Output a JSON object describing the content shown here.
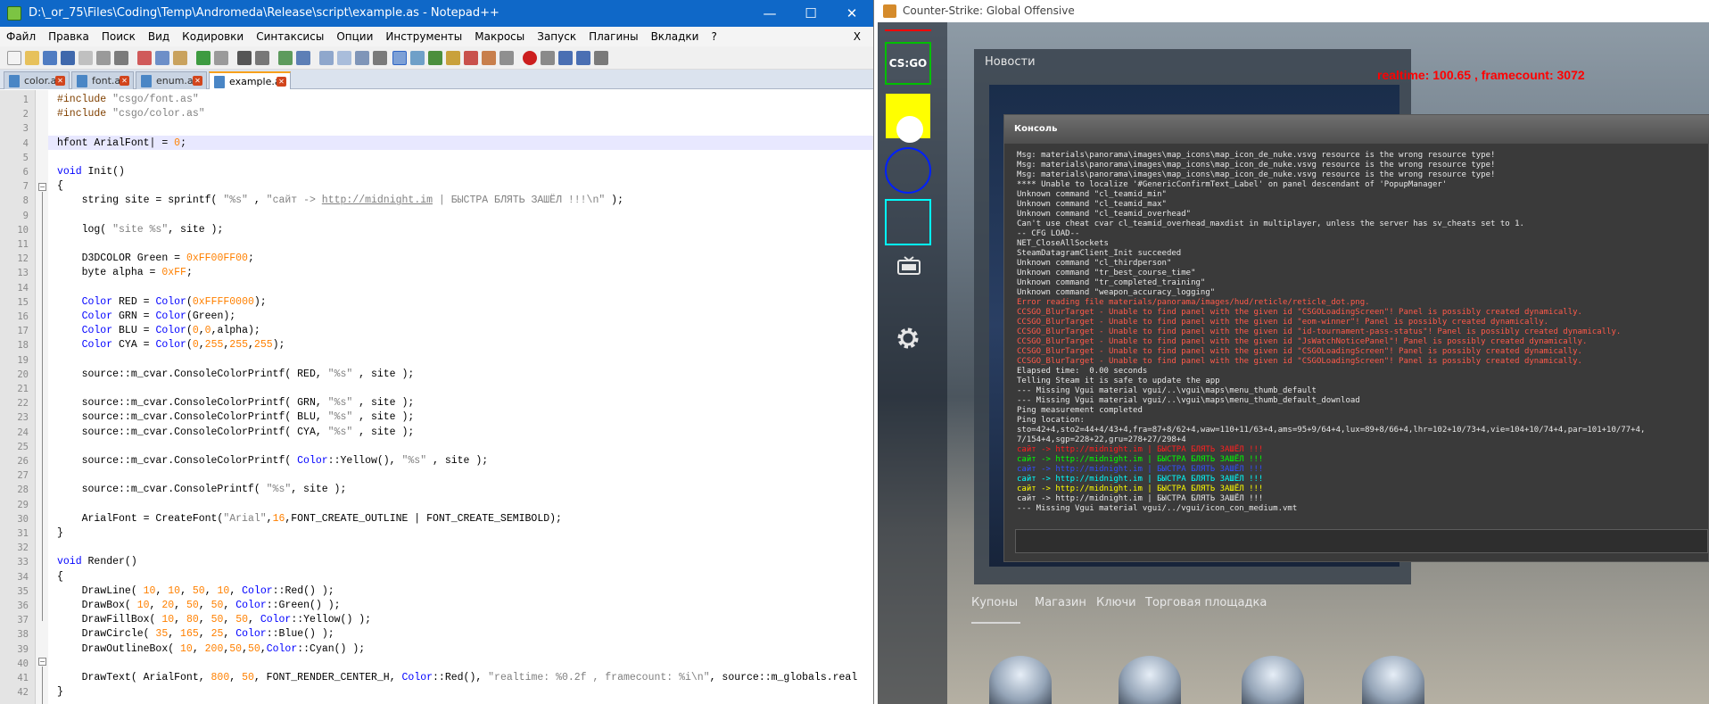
{
  "npp": {
    "title": "D:\\_or_75\\Files\\Coding\\Temp\\Andromeda\\Release\\script\\example.as - Notepad++",
    "window_min": "—",
    "window_max": "☐",
    "window_close": "✕",
    "menu": [
      "Файл",
      "Правка",
      "Поиск",
      "Вид",
      "Кодировки",
      "Синтаксисы",
      "Опции",
      "Инструменты",
      "Макросы",
      "Запуск",
      "Плагины",
      "Вкладки",
      "?"
    ],
    "menu_close": "X",
    "tabs": [
      {
        "label": "color.as",
        "active": false
      },
      {
        "label": "font.as",
        "active": false
      },
      {
        "label": "enum.as",
        "active": false
      },
      {
        "label": "example.as",
        "active": true
      }
    ],
    "tab_close": "✕",
    "line_numbers": [
      "1",
      "2",
      "3",
      "4",
      "5",
      "6",
      "7",
      "8",
      "9",
      "10",
      "11",
      "12",
      "13",
      "14",
      "15",
      "16",
      "17",
      "18",
      "19",
      "20",
      "21",
      "22",
      "23",
      "24",
      "25",
      "26",
      "27",
      "28",
      "29",
      "30",
      "31",
      "32",
      "33",
      "34",
      "35",
      "36",
      "37",
      "38",
      "39",
      "40",
      "41",
      "42"
    ],
    "code": [
      [
        {
          "t": "#include ",
          "c": "p"
        },
        {
          "t": "\"csgo/font.as\"",
          "c": "s"
        }
      ],
      [
        {
          "t": "#include ",
          "c": "p"
        },
        {
          "t": "\"csgo/color.as\"",
          "c": "s"
        }
      ],
      [],
      [
        {
          "t": "hfont ArialFont",
          "c": ""
        },
        {
          "t": "|",
          "c": ""
        },
        {
          "t": " = ",
          "c": ""
        },
        {
          "t": "0",
          "c": "n"
        },
        {
          "t": ";",
          "c": ""
        }
      ],
      [],
      [
        {
          "t": "void ",
          "c": "k"
        },
        {
          "t": "Init()",
          "c": ""
        }
      ],
      [
        {
          "t": "{",
          "c": ""
        }
      ],
      [
        {
          "t": "    string site = sprintf( ",
          "c": ""
        },
        {
          "t": "\"%s\"",
          "c": "s"
        },
        {
          "t": " , ",
          "c": ""
        },
        {
          "t": "\"сайт -> ",
          "c": "s"
        },
        {
          "t": "http://midnight.im",
          "c": "u"
        },
        {
          "t": " | БЫСТРА БЛЯТЬ ЗАШЁЛ !!!\\n\"",
          "c": "s"
        },
        {
          "t": " );",
          "c": ""
        }
      ],
      [],
      [
        {
          "t": "    log( ",
          "c": ""
        },
        {
          "t": "\"site %s\"",
          "c": "s"
        },
        {
          "t": ", site );",
          "c": ""
        }
      ],
      [],
      [
        {
          "t": "    D3DCOLOR Green = ",
          "c": ""
        },
        {
          "t": "0xFF00FF00",
          "c": "n"
        },
        {
          "t": ";",
          "c": ""
        }
      ],
      [
        {
          "t": "    byte alpha = ",
          "c": ""
        },
        {
          "t": "0xFF",
          "c": "n"
        },
        {
          "t": ";",
          "c": ""
        }
      ],
      [],
      [
        {
          "t": "    Color",
          "c": "k"
        },
        {
          "t": " RED = ",
          "c": ""
        },
        {
          "t": "Color",
          "c": "k"
        },
        {
          "t": "(",
          "c": ""
        },
        {
          "t": "0xFFFF0000",
          "c": "n"
        },
        {
          "t": ");",
          "c": ""
        }
      ],
      [
        {
          "t": "    Color",
          "c": "k"
        },
        {
          "t": " GRN = ",
          "c": ""
        },
        {
          "t": "Color",
          "c": "k"
        },
        {
          "t": "(Green);",
          "c": ""
        }
      ],
      [
        {
          "t": "    Color",
          "c": "k"
        },
        {
          "t": " BLU = ",
          "c": ""
        },
        {
          "t": "Color",
          "c": "k"
        },
        {
          "t": "(",
          "c": ""
        },
        {
          "t": "0",
          "c": "n"
        },
        {
          "t": ",",
          "c": ""
        },
        {
          "t": "0",
          "c": "n"
        },
        {
          "t": ",alpha);",
          "c": ""
        }
      ],
      [
        {
          "t": "    Color",
          "c": "k"
        },
        {
          "t": " CYA = ",
          "c": ""
        },
        {
          "t": "Color",
          "c": "k"
        },
        {
          "t": "(",
          "c": ""
        },
        {
          "t": "0",
          "c": "n"
        },
        {
          "t": ",",
          "c": ""
        },
        {
          "t": "255",
          "c": "n"
        },
        {
          "t": ",",
          "c": ""
        },
        {
          "t": "255",
          "c": "n"
        },
        {
          "t": ",",
          "c": ""
        },
        {
          "t": "255",
          "c": "n"
        },
        {
          "t": ");",
          "c": ""
        }
      ],
      [],
      [
        {
          "t": "    source::m_cvar.ConsoleColorPrintf( RED, ",
          "c": ""
        },
        {
          "t": "\"%s\"",
          "c": "s"
        },
        {
          "t": " , site );",
          "c": ""
        }
      ],
      [],
      [
        {
          "t": "    source::m_cvar.ConsoleColorPrintf( GRN, ",
          "c": ""
        },
        {
          "t": "\"%s\"",
          "c": "s"
        },
        {
          "t": " , site );",
          "c": ""
        }
      ],
      [
        {
          "t": "    source::m_cvar.ConsoleColorPrintf( BLU, ",
          "c": ""
        },
        {
          "t": "\"%s\"",
          "c": "s"
        },
        {
          "t": " , site );",
          "c": ""
        }
      ],
      [
        {
          "t": "    source::m_cvar.ConsoleColorPrintf( CYA, ",
          "c": ""
        },
        {
          "t": "\"%s\"",
          "c": "s"
        },
        {
          "t": " , site );",
          "c": ""
        }
      ],
      [],
      [
        {
          "t": "    source::m_cvar.ConsoleColorPrintf( ",
          "c": ""
        },
        {
          "t": "Color",
          "c": "k"
        },
        {
          "t": "::Yellow(), ",
          "c": ""
        },
        {
          "t": "\"%s\"",
          "c": "s"
        },
        {
          "t": " , site );",
          "c": ""
        }
      ],
      [],
      [
        {
          "t": "    source::m_cvar.ConsolePrintf( ",
          "c": ""
        },
        {
          "t": "\"%s\"",
          "c": "s"
        },
        {
          "t": ", site );",
          "c": ""
        }
      ],
      [],
      [
        {
          "t": "    ArialFont = CreateFont(",
          "c": ""
        },
        {
          "t": "\"Arial\"",
          "c": "s"
        },
        {
          "t": ",",
          "c": ""
        },
        {
          "t": "16",
          "c": "n"
        },
        {
          "t": ",FONT_CREATE_OUTLINE | FONT_CREATE_SEMIBOLD);",
          "c": ""
        }
      ],
      [
        {
          "t": "}",
          "c": ""
        }
      ],
      [],
      [
        {
          "t": "void ",
          "c": "k"
        },
        {
          "t": "Render()",
          "c": ""
        }
      ],
      [
        {
          "t": "{",
          "c": ""
        }
      ],
      [
        {
          "t": "    DrawLine( ",
          "c": ""
        },
        {
          "t": "10",
          "c": "n"
        },
        {
          "t": ", ",
          "c": ""
        },
        {
          "t": "10",
          "c": "n"
        },
        {
          "t": ", ",
          "c": ""
        },
        {
          "t": "50",
          "c": "n"
        },
        {
          "t": ", ",
          "c": ""
        },
        {
          "t": "10",
          "c": "n"
        },
        {
          "t": ", ",
          "c": ""
        },
        {
          "t": "Color",
          "c": "k"
        },
        {
          "t": "::Red() );",
          "c": ""
        }
      ],
      [
        {
          "t": "    DrawBox( ",
          "c": ""
        },
        {
          "t": "10",
          "c": "n"
        },
        {
          "t": ", ",
          "c": ""
        },
        {
          "t": "20",
          "c": "n"
        },
        {
          "t": ", ",
          "c": ""
        },
        {
          "t": "50",
          "c": "n"
        },
        {
          "t": ", ",
          "c": ""
        },
        {
          "t": "50",
          "c": "n"
        },
        {
          "t": ", ",
          "c": ""
        },
        {
          "t": "Color",
          "c": "k"
        },
        {
          "t": "::Green() );",
          "c": ""
        }
      ],
      [
        {
          "t": "    DrawFillBox( ",
          "c": ""
        },
        {
          "t": "10",
          "c": "n"
        },
        {
          "t": ", ",
          "c": ""
        },
        {
          "t": "80",
          "c": "n"
        },
        {
          "t": ", ",
          "c": ""
        },
        {
          "t": "50",
          "c": "n"
        },
        {
          "t": ", ",
          "c": ""
        },
        {
          "t": "50",
          "c": "n"
        },
        {
          "t": ", ",
          "c": ""
        },
        {
          "t": "Color",
          "c": "k"
        },
        {
          "t": "::Yellow() );",
          "c": ""
        }
      ],
      [
        {
          "t": "    DrawCircle( ",
          "c": ""
        },
        {
          "t": "35",
          "c": "n"
        },
        {
          "t": ", ",
          "c": ""
        },
        {
          "t": "165",
          "c": "n"
        },
        {
          "t": ", ",
          "c": ""
        },
        {
          "t": "25",
          "c": "n"
        },
        {
          "t": ", ",
          "c": ""
        },
        {
          "t": "Color",
          "c": "k"
        },
        {
          "t": "::Blue() );",
          "c": ""
        }
      ],
      [
        {
          "t": "    DrawOutlineBox( ",
          "c": ""
        },
        {
          "t": "10",
          "c": "n"
        },
        {
          "t": ", ",
          "c": ""
        },
        {
          "t": "200",
          "c": "n"
        },
        {
          "t": ",",
          "c": ""
        },
        {
          "t": "50",
          "c": "n"
        },
        {
          "t": ",",
          "c": ""
        },
        {
          "t": "50",
          "c": "n"
        },
        {
          "t": ",",
          "c": ""
        },
        {
          "t": "Color",
          "c": "k"
        },
        {
          "t": "::Cyan() );",
          "c": ""
        }
      ],
      [],
      [
        {
          "t": "    DrawText( ArialFont, ",
          "c": ""
        },
        {
          "t": "800",
          "c": "n"
        },
        {
          "t": ", ",
          "c": ""
        },
        {
          "t": "50",
          "c": "n"
        },
        {
          "t": ", FONT_RENDER_CENTER_H, ",
          "c": ""
        },
        {
          "t": "Color",
          "c": "k"
        },
        {
          "t": "::Red(), ",
          "c": ""
        },
        {
          "t": "\"realtime: %0.2f , framecount: %i\\n\"",
          "c": "s"
        },
        {
          "t": ", source::m_globals.real",
          "c": ""
        }
      ],
      [
        {
          "t": "}",
          "c": ""
        }
      ]
    ]
  },
  "csgo": {
    "title": "Counter-Strike: Global Offensive",
    "logo": "CS:GO",
    "news_title": "Новости",
    "realtime_text": "realtime: 100.65 , framecount: 3072",
    "console_title": "Консоль",
    "bottom_tabs": [
      "Купоны",
      "Магазин",
      "Ключи",
      "Торговая площадка"
    ],
    "console_lines": [
      {
        "t": "Msg: materials\\panorama\\images\\map_icons\\map_icon_de_nuke.vsvg resource is the wrong resource type!",
        "c": "#e8e8e8"
      },
      {
        "t": "Msg: materials\\panorama\\images\\map_icons\\map_icon_de_nuke.vsvg resource is the wrong resource type!",
        "c": "#e8e8e8"
      },
      {
        "t": "Msg: materials\\panorama\\images\\map_icons\\map_icon_de_nuke.vsvg resource is the wrong resource type!",
        "c": "#e8e8e8"
      },
      {
        "t": "**** Unable to localize '#GenericConfirmText_Label' on panel descendant of 'PopupManager'",
        "c": "#e8e8e8"
      },
      {
        "t": "Unknown command \"cl_teamid_min\"",
        "c": "#e8e8e8"
      },
      {
        "t": "Unknown command \"cl_teamid_max\"",
        "c": "#e8e8e8"
      },
      {
        "t": "Unknown command \"cl_teamid_overhead\"",
        "c": "#e8e8e8"
      },
      {
        "t": "Can't use cheat cvar cl_teamid_overhead_maxdist in multiplayer, unless the server has sv_cheats set to 1.",
        "c": "#e8e8e8"
      },
      {
        "t": "-- CFG LOAD--",
        "c": "#e8e8e8"
      },
      {
        "t": "NET_CloseAllSockets",
        "c": "#e8e8e8"
      },
      {
        "t": "SteamDatagramClient_Init succeeded",
        "c": "#e8e8e8"
      },
      {
        "t": "Unknown command \"cl_thirdperson\"",
        "c": "#e8e8e8"
      },
      {
        "t": "Unknown command \"tr_best_course_time\"",
        "c": "#e8e8e8"
      },
      {
        "t": "Unknown command \"tr_completed_training\"",
        "c": "#e8e8e8"
      },
      {
        "t": "Unknown command \"weapon_accuracy_logging\"",
        "c": "#e8e8e8"
      },
      {
        "t": "Error reading file materials/panorama/images/hud/reticle/reticle_dot.png.",
        "c": "#ff5a4a"
      },
      {
        "t": "CCSGO_BlurTarget - Unable to find panel with the given id \"CSGOLoadingScreen\"! Panel is possibly created dynamically.",
        "c": "#ff5a4a"
      },
      {
        "t": "CCSGO_BlurTarget - Unable to find panel with the given id \"eom-winner\"! Panel is possibly created dynamically.",
        "c": "#ff5a4a"
      },
      {
        "t": "CCSGO_BlurTarget - Unable to find panel with the given id \"id-tournament-pass-status\"! Panel is possibly created dynamically.",
        "c": "#ff5a4a"
      },
      {
        "t": "CCSGO_BlurTarget - Unable to find panel with the given id \"JsWatchNoticePanel\"! Panel is possibly created dynamically.",
        "c": "#ff5a4a"
      },
      {
        "t": "CCSGO_BlurTarget - Unable to find panel with the given id \"CSGOLoadingScreen\"! Panel is possibly created dynamically.",
        "c": "#ff5a4a"
      },
      {
        "t": "CCSGO_BlurTarget - Unable to find panel with the given id \"CSGOLoadingScreen\"! Panel is possibly created dynamically.",
        "c": "#ff5a4a"
      },
      {
        "t": "Elapsed time:  0.00 seconds",
        "c": "#e8e8e8"
      },
      {
        "t": "Telling Steam it is safe to update the app",
        "c": "#e8e8e8"
      },
      {
        "t": "--- Missing Vgui material vgui/..\\vgui\\maps\\menu_thumb_default",
        "c": "#e8e8e8"
      },
      {
        "t": "--- Missing Vgui material vgui/..\\vgui\\maps\\menu_thumb_default_download",
        "c": "#e8e8e8"
      },
      {
        "t": "Ping measurement completed",
        "c": "#e8e8e8"
      },
      {
        "t": "Ping location:",
        "c": "#e8e8e8"
      },
      {
        "t": "sto=42+4,sto2=44+4/43+4,fra=87+8/62+4,waw=110+11/63+4,ams=95+9/64+4,lux=89+8/66+4,lhr=102+10/73+4,vie=104+10/74+4,par=101+10/77+4,",
        "c": "#e8e8e8"
      },
      {
        "t": "7/154+4,sgp=228+22,gru=278+27/298+4",
        "c": "#e8e8e8"
      },
      {
        "t": "сайт -> http://midnight.im | БЫСТРА БЛЯТЬ ЗАШЁЛ !!!",
        "c": "#ff2020"
      },
      {
        "t": "сайт -> http://midnight.im | БЫСТРА БЛЯТЬ ЗАШЁЛ !!!",
        "c": "#00ff00"
      },
      {
        "t": "сайт -> http://midnight.im | БЫСТРА БЛЯТЬ ЗАШЁЛ !!!",
        "c": "#3050ff"
      },
      {
        "t": "сайт -> http://midnight.im | БЫСТРА БЛЯТЬ ЗАШЁЛ !!!",
        "c": "#00ffff"
      },
      {
        "t": "сайт -> http://midnight.im | БЫСТРА БЛЯТЬ ЗАШЁЛ !!!",
        "c": "#ffff00"
      },
      {
        "t": "сайт -> http://midnight.im | БЫСТРА БЛЯТЬ ЗАШЁЛ !!!",
        "c": "#e8e8e8"
      },
      {
        "t": "--- Missing Vgui material vgui/../vgui/icon_con_medium.vmt",
        "c": "#e8e8e8"
      }
    ]
  }
}
